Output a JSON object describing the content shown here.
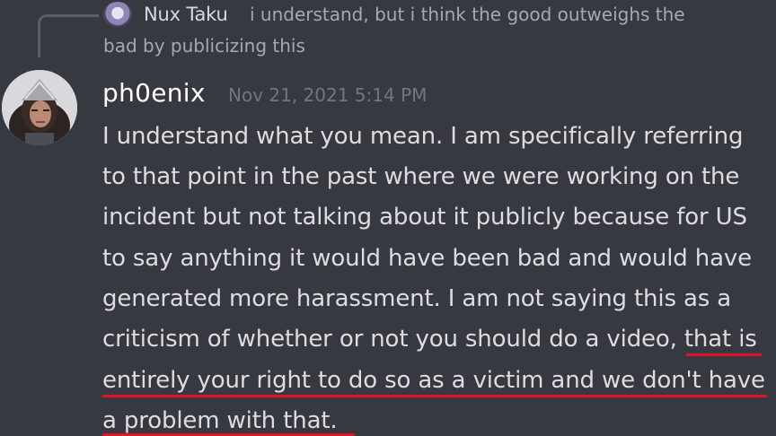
{
  "reply": {
    "author": "Nux Taku",
    "text_line1": "i understand, but i think the good outweighs the",
    "text_line2": "bad by publicizing this"
  },
  "message": {
    "author": "ph0enix",
    "timestamp": "Nov 21, 2021 5:14 PM",
    "lines": [
      "I understand what you mean. I am specifically referring",
      "to that point in the past where we were working on the",
      "incident but not talking about it publicly because for US",
      "to say anything it would have been bad and would have",
      "generated more harassment. I am not saying this as a",
      "criticism of whether or not you should do a video, that is",
      "entirely your right to do so as a victim and we don't have",
      "a problem with that."
    ]
  },
  "colors": {
    "background": "#36393f",
    "underline": "#e3122a"
  }
}
